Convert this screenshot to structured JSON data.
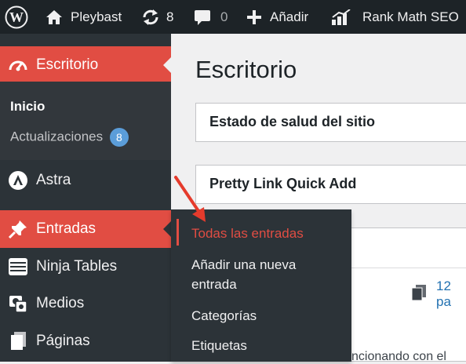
{
  "adminbar": {
    "site_name": "Pleybast",
    "updates_count": "8",
    "comments_count": "0",
    "new_label": "Añadir",
    "seo_label": "Rank Math SEO"
  },
  "sidebar": {
    "dashboard": {
      "label": "Escritorio",
      "icon": "dashboard-icon"
    },
    "dashboard_submenu": [
      {
        "label": "Inicio"
      },
      {
        "label": "Actualizaciones",
        "badge": "8"
      }
    ],
    "items": [
      {
        "label": "Astra",
        "icon": "astra-icon"
      },
      {
        "label": "Entradas",
        "icon": "pin-icon"
      },
      {
        "label": "Ninja Tables",
        "icon": "table-icon"
      },
      {
        "label": "Medios",
        "icon": "media-icon"
      },
      {
        "label": "Páginas",
        "icon": "pages-icon"
      }
    ]
  },
  "flyout": {
    "items": [
      {
        "label": "Todas las entradas"
      },
      {
        "label": "Añadir una nueva"
      },
      {
        "label": "entrada"
      },
      {
        "label": "Categorías"
      },
      {
        "label": "Etiquetas"
      }
    ]
  },
  "main": {
    "title": "Escritorio",
    "postboxes": [
      {
        "title": "Estado de salud del sitio"
      },
      {
        "title": "Pretty Link Quick Add"
      }
    ],
    "glance_text": "12 pa",
    "footer_text": "ncionando con el"
  },
  "colors": {
    "adminbar_bg": "#1d2327",
    "sidebar_bg": "#2c3338",
    "accent": "#e14d43",
    "badge": "#5b9dd9",
    "link": "#2271b1"
  }
}
